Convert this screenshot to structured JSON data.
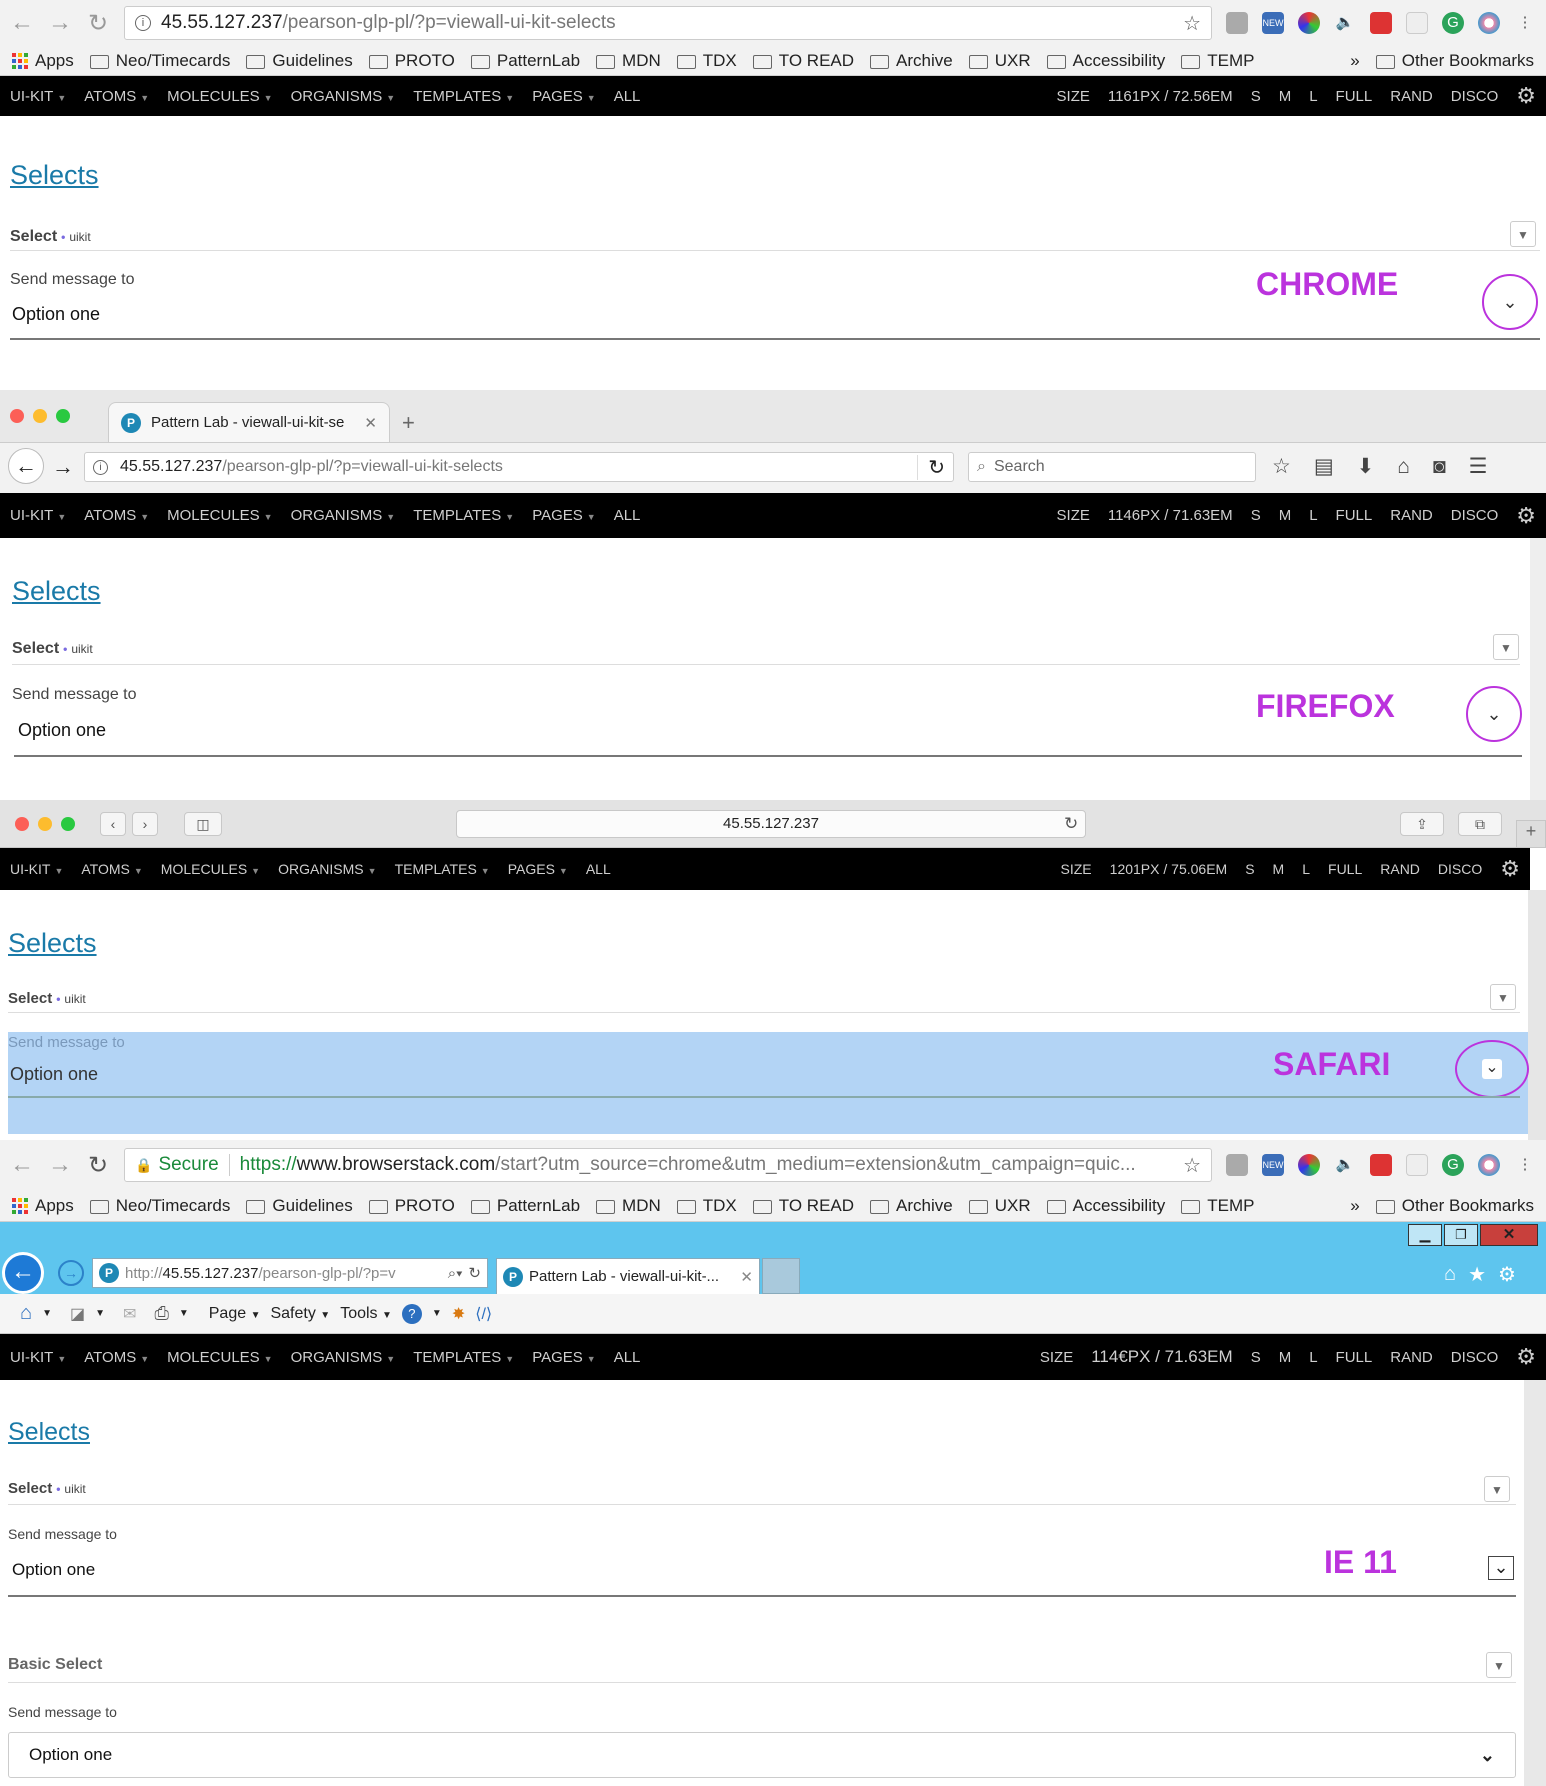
{
  "chrome": {
    "url_host": "45.55.127.237",
    "url_path": "/pearson-glp-pl/?p=viewall-ui-kit-selects",
    "bookmarks": [
      "Apps",
      "Neo/Timecards",
      "Guidelines",
      "PROTO",
      "PatternLab",
      "MDN",
      "TDX",
      "TO READ",
      "Archive",
      "UXR",
      "Accessibility",
      "TEMP"
    ],
    "more": "»",
    "other_bookmarks": "Other Bookmarks",
    "size_px": "1161PX /",
    "size_em": "72.56EM",
    "tag": "CHROME"
  },
  "plnav": {
    "left": [
      "UI-KIT",
      "ATOMS",
      "MOLECULES",
      "ORGANISMS",
      "TEMPLATES",
      "PAGES"
    ],
    "all": "ALL",
    "size_label": "SIZE",
    "right": [
      "S",
      "M",
      "L",
      "FULL",
      "RAND",
      "DISCO"
    ]
  },
  "content": {
    "heading": "Selects",
    "select_title": "Select",
    "select_dot": "•",
    "select_kit": "uikit",
    "label": "Send message to",
    "value": "Option one",
    "toggle_glyph": "▼",
    "chevron": "⌄"
  },
  "firefox": {
    "tab_title": "Pattern Lab - viewall-ui-kit-se",
    "url_host": "45.55.127.237",
    "url_path": "/pearson-glp-pl/?p=viewall-ui-kit-selects",
    "search_placeholder": "Search",
    "size_px": "1146PX /",
    "size_em": "71.63EM",
    "tag": "FIREFOX"
  },
  "safari": {
    "url": "45.55.127.237",
    "size_px": "1201PX /",
    "size_em": "75.06EM",
    "tag": "SAFARI",
    "highlight_color": "#b3d4f5"
  },
  "chrome2": {
    "secure": "Secure",
    "url_scheme": "https://",
    "url_host": "www.browserstack.com",
    "url_path": "/start?utm_source=chrome&utm_medium=extension&utm_campaign=quic..."
  },
  "ie": {
    "url_prefix": "http://",
    "url_host": "45.55.127.237",
    "url_path": "/pearson-glp-pl/?p=v",
    "tab_title": "Pattern Lab - viewall-ui-kit-...",
    "cmd": [
      "Page",
      "Safety",
      "Tools"
    ],
    "size_px": "114€PX /",
    "size_em": "71.63EM",
    "tag": "IE 11",
    "basic_select": "Basic Select",
    "basic_label": "Send message to",
    "basic_value": "Option one"
  },
  "colors": {
    "accent": "#bb33dd",
    "link": "#1a7aa8",
    "ie_chrome": "#5ec5ee"
  }
}
